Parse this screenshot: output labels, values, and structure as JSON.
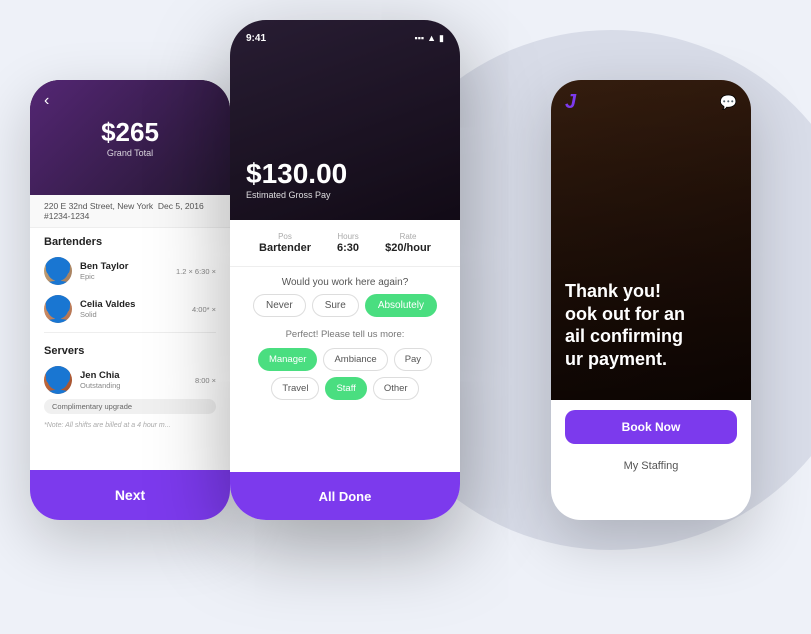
{
  "background": {
    "circle_color": "#d8dce8"
  },
  "left_phone": {
    "amount": "$265",
    "grand_total_label": "Grand Total",
    "address": "220 E 32nd Street, New York",
    "date": "Dec 5, 2016",
    "order_id": "#1234-1234",
    "bartenders_label": "Bartenders",
    "servers_label": "Servers",
    "staff": [
      {
        "name": "Ben Taylor",
        "sub": "Epic",
        "rate": "1.2 × 6:30 ×",
        "avatar_class": "ben"
      },
      {
        "name": "Celia Valdes",
        "sub": "Solid",
        "rate": "4:00* ×",
        "avatar_class": "celia"
      }
    ],
    "server": {
      "name": "Jen Chia",
      "sub": "Outstanding",
      "rate": "8:00 ×",
      "avatar_class": "jen",
      "upgrade": "Complimentary upgrade"
    },
    "note": "*Note: All shifts are billed at a 4 hour m...",
    "next_label": "Next"
  },
  "center_phone": {
    "status_time": "9:41",
    "amount": "$130.00",
    "estimated_gross_pay_label": "Estimated Gross Pay",
    "pos_label": "Pos",
    "pos_value": "Bartender",
    "hours_label": "Hours",
    "hours_value": "6:30",
    "rate_label": "Rate",
    "rate_value": "$20/hour",
    "question": "Would you work here again?",
    "never_label": "Never",
    "sure_label": "Sure",
    "absolutely_label": "Absolutely",
    "please_more": "Perfect! Please tell us more:",
    "tags": [
      {
        "label": "Manager",
        "active": true
      },
      {
        "label": "Ambiance",
        "active": false
      },
      {
        "label": "Pay",
        "active": false
      },
      {
        "label": "Travel",
        "active": false
      },
      {
        "label": "Staff",
        "active": true
      },
      {
        "label": "Other",
        "active": false
      }
    ],
    "all_done_label": "All Done"
  },
  "right_phone": {
    "logo": "J",
    "hero_text_line1": "Thank you!",
    "hero_text_line2": "ook out for an",
    "hero_text_line3": "ail confirming",
    "hero_text_line4": "ur payment.",
    "book_now_label": "Book Now",
    "my_staffing_label": "My Staffing"
  }
}
